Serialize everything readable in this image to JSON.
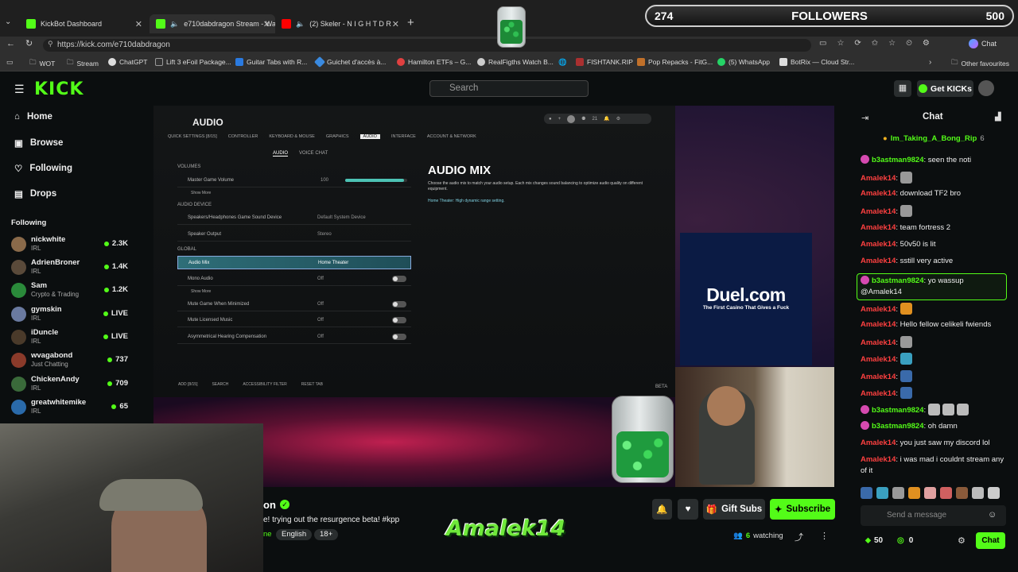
{
  "browser": {
    "tabs": [
      {
        "label": "KickBot Dashboard",
        "icon": "kickbot-favicon"
      },
      {
        "label": "e710dabdragon Stream - Wa",
        "icon": "kick-favicon"
      },
      {
        "label": "(2) Skeler - N I G H T D R",
        "icon": "youtube-favicon"
      }
    ],
    "url": "https://kick.com/e710dabdragon",
    "bookmarks": [
      "WOT",
      "Stream",
      "ChatGPT",
      "Lift 3 eFoil Package...",
      "Guitar Tabs with R...",
      "Guichet d'accès à...",
      "Hamilton ETFs – G...",
      "RealFigths Watch B...",
      "FISHTANK.RIP",
      "Pop Repacks - FitG...",
      "(5) WhatsApp",
      "BotRix — Cloud Str...",
      "Other favourites"
    ],
    "copilot_label": "Chat"
  },
  "overlay": {
    "followers_current": "274",
    "followers_label": "FOLLOWERS",
    "followers_goal": "500"
  },
  "header": {
    "search_placeholder": "Search",
    "get_kicks": "Get KICKs",
    "logo": "KICK"
  },
  "sidebar": {
    "nav": [
      "Home",
      "Browse",
      "Following",
      "Drops"
    ],
    "following_title": "Following",
    "following": [
      {
        "name": "nickwhite",
        "category": "IRL",
        "viewers": "2.3K",
        "color": "#8a6a4a"
      },
      {
        "name": "AdrienBroner",
        "category": "IRL",
        "viewers": "1.4K",
        "color": "#5a4a3a"
      },
      {
        "name": "Sam",
        "category": "Crypto & Trading",
        "viewers": "1.2K",
        "color": "#2a8a3a"
      },
      {
        "name": "gymskin",
        "category": "IRL",
        "viewers": "LIVE",
        "color": "#6a7aa0"
      },
      {
        "name": "iDuncle",
        "category": "IRL",
        "viewers": "LIVE",
        "color": "#4a3a2a"
      },
      {
        "name": "wvagabond",
        "category": "Just Chatting",
        "viewers": "737",
        "color": "#8a3a2a"
      },
      {
        "name": "ChickenAndy",
        "category": "IRL",
        "viewers": "709",
        "color": "#3a6a3a"
      },
      {
        "name": "greatwhitemike",
        "category": "IRL",
        "viewers": "65",
        "color": "#2a6aaa"
      }
    ]
  },
  "game": {
    "title": "AUDIO",
    "tabs": [
      "QUICK SETTINGS [8/15]",
      "CONTROLLER",
      "KEYBOARD & MOUSE",
      "GRAPHICS",
      "AUDIO",
      "INTERFACE",
      "ACCOUNT & NETWORK"
    ],
    "subtabs": [
      "AUDIO",
      "VOICE CHAT"
    ],
    "players": "21",
    "sections": [
      "VOLUMES",
      "AUDIO DEVICE",
      "GLOBAL"
    ],
    "master_label": "Master Game Volume",
    "master_value": "100",
    "master_level": 0.95,
    "show_more": "Show More",
    "rows": [
      {
        "label": "Speakers/Headphones Game Sound Device",
        "value": "Default System Device"
      },
      {
        "label": "Speaker Output",
        "value": "Stereo"
      },
      {
        "label": "Audio Mix",
        "value": "Home Theater"
      },
      {
        "label": "Mono Audio",
        "value": "Off"
      },
      {
        "label": "Mute Game When Minimized",
        "value": "Off"
      },
      {
        "label": "Mute Licensed Music",
        "value": "Off"
      },
      {
        "label": "Asymmetrical Hearing Compensation",
        "value": "Off"
      }
    ],
    "mix_title": "AUDIO MIX",
    "mix_desc": "Choose the audio mix to match your audio setup. Each mix changes sound balancing to optimize audio quality on different equipment.",
    "mix_note": "Home Theater: High dynamic range setting.",
    "footer": [
      "ADD [8/15]",
      "SEARCH",
      "ACCESSIBILITY FILTER",
      "RESET TAB"
    ],
    "beta": "BETA"
  },
  "ad": {
    "brand": "Duel.com",
    "tagline": "The First Casino That Gives a Fuck"
  },
  "stream": {
    "title_tail": "on",
    "desc": "e! trying out the resurgence beta!  #kpp",
    "tags": [
      "ne",
      "English",
      "18+"
    ],
    "watching_count": "6",
    "watching_label": "watching",
    "gift": "Gift Subs",
    "subscribe": "Subscribe",
    "brand_overlay": "Amalek14"
  },
  "chat": {
    "title": "Chat",
    "pinned": {
      "name": "Im_Taking_A_Bong_Rip",
      "count": "6"
    },
    "messages": [
      {
        "user": "b3astman9824",
        "text": "seen the noti",
        "color": "#53fc18",
        "badge": true
      },
      {
        "user": "Amalek14",
        "text": "",
        "color": "#ff4040",
        "emote": "robot"
      },
      {
        "user": "Amalek14",
        "text": "download TF2 bro",
        "color": "#ff4040"
      },
      {
        "user": "Amalek14",
        "text": "",
        "color": "#ff4040",
        "emote": "robot"
      },
      {
        "user": "Amalek14",
        "text": "team fortress 2",
        "color": "#ff4040"
      },
      {
        "user": "Amalek14",
        "text": "50v50 is lit",
        "color": "#ff4040"
      },
      {
        "user": "Amalek14",
        "text": "sstill very active",
        "color": "#ff4040"
      },
      {
        "user": "b3astman9824",
        "text": "yo wassup @Amalek14",
        "color": "#53fc18",
        "badge": true,
        "highlight": true
      },
      {
        "user": "Amalek14",
        "text": "",
        "color": "#ff4040",
        "emote": "butterfly"
      },
      {
        "user": "Amalek14",
        "text": "Hello fellow celikeli fwiends",
        "color": "#ff4040"
      },
      {
        "user": "Amalek14",
        "text": "",
        "color": "#ff4040",
        "emote": "robot"
      },
      {
        "user": "Amalek14",
        "text": "",
        "color": "#ff4040",
        "emote": "box"
      },
      {
        "user": "Amalek14",
        "text": "",
        "color": "#ff4040",
        "emote": "bird"
      },
      {
        "user": "Amalek14",
        "text": "",
        "color": "#ff4040",
        "emote": "bird"
      },
      {
        "user": "b3astman9824",
        "text": "",
        "color": "#53fc18",
        "badge": true,
        "emote": "chess"
      },
      {
        "user": "b3astman9824",
        "text": "oh damn",
        "color": "#53fc18",
        "badge": true
      },
      {
        "user": "Amalek14",
        "text": "you just saw my discord lol",
        "color": "#ff4040"
      },
      {
        "user": "Amalek14",
        "text": "i was mad i couldnt stream any of it",
        "color": "#ff4040"
      }
    ],
    "send_placeholder": "Send a message",
    "kicks": "50",
    "points": "0",
    "send_button": "Chat"
  }
}
